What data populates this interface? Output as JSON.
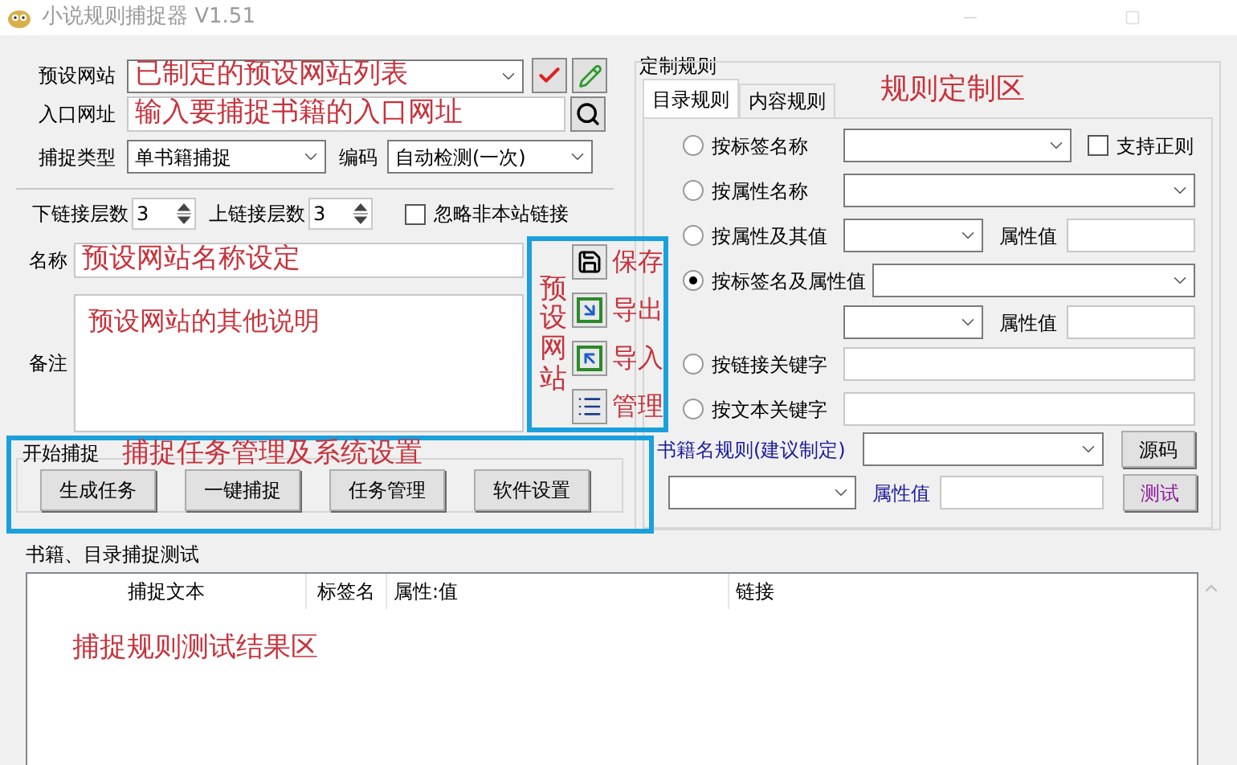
{
  "window": {
    "title": "小说规则捕捉器 V1.51"
  },
  "preset": {
    "label": "预设网站",
    "value": "已制定的预设网站列表"
  },
  "entry": {
    "label": "入口网址",
    "value": "输入要捕捉书籍的入口网址"
  },
  "capture_type": {
    "label": "捕捉类型",
    "value": "单书籍捕捉"
  },
  "encoding": {
    "label": "编码",
    "value": "自动检测(一次)"
  },
  "depth": {
    "down_label": "下链接层数",
    "down_value": "3",
    "up_label": "上链接层数",
    "up_value": "3"
  },
  "ignore_external": {
    "label": "忽略非本站链接",
    "checked": false
  },
  "name": {
    "label": "名称",
    "value": "预设网站名称设定"
  },
  "note": {
    "label": "备注",
    "value": "预设网站的其他说明"
  },
  "preset_actions": {
    "annotation": "预设网站",
    "items": [
      {
        "kind": "save",
        "label": "保存"
      },
      {
        "kind": "export",
        "label": "导出"
      },
      {
        "kind": "import",
        "label": "导入"
      },
      {
        "kind": "manage",
        "label": "管理"
      }
    ]
  },
  "capture_group": {
    "title": "开始捕捉",
    "annotation": "捕捉任务管理及系统设置",
    "buttons": [
      "生成任务",
      "一键捕捉",
      "任务管理",
      "软件设置"
    ]
  },
  "rules": {
    "title": "定制规则",
    "annotation": "规则定制区",
    "tabs": [
      {
        "label": "目录规则",
        "selected": true
      },
      {
        "label": "内容规则",
        "selected": false
      }
    ],
    "options": [
      {
        "kind": "combo_check",
        "label": "按标签名称",
        "selected": false,
        "check": {
          "label": "支持正则",
          "checked": false
        }
      },
      {
        "kind": "combo",
        "label": "按属性名称",
        "selected": false
      },
      {
        "kind": "combo_attr",
        "label": "按属性及其值",
        "selected": false,
        "attr_label": "属性值"
      },
      {
        "kind": "combo",
        "label": "按标签名及属性值",
        "selected": true,
        "sub_attr_label": "属性值"
      },
      {
        "kind": "input",
        "label": "按链接关键字",
        "selected": false
      },
      {
        "kind": "input",
        "label": "按文本关键字",
        "selected": false
      }
    ],
    "book_name": {
      "label": "书籍名规则(建议制定)",
      "attr_label": "属性值",
      "source_button": "源码",
      "test_button": "测试"
    }
  },
  "test": {
    "title": "书籍、目录捕捉测试",
    "columns": [
      "捕捉文本",
      "标签名",
      "属性:值",
      "链接"
    ],
    "annotation": "捕捉规则测试结果区"
  }
}
